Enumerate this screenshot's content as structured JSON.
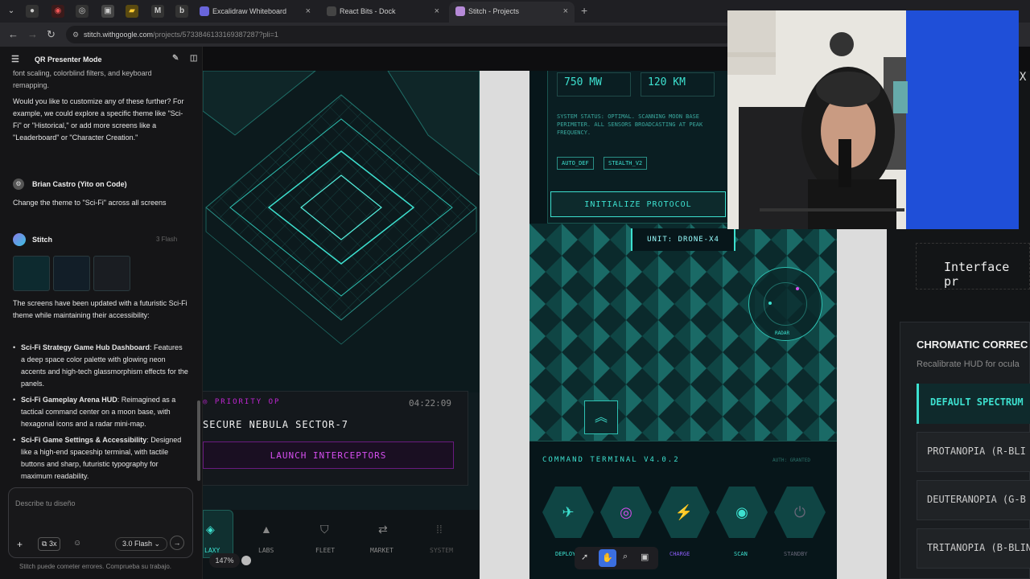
{
  "browser": {
    "tabs": [
      {
        "label": "Excalidraw Whiteboard",
        "active": false
      },
      {
        "label": "React Bits - Dock",
        "active": false
      },
      {
        "label": "Stitch - Projects",
        "active": true
      }
    ],
    "url_host": "stitch.withgoogle.com",
    "url_path": "/projects/5733846133169387287?pli=1"
  },
  "chat": {
    "title": "QR Presenter Mode",
    "intro_tail": "font scaling, colorblind filters, and keyboard remapping.",
    "question": "Would you like to customize any of these further? For example, we could explore a specific theme like \"Sci-Fi\" or \"Historical,\" or add more screens like a \"Leaderboard\" or \"Character Creation.\"",
    "user_name": "Brian Castro (Yito on Code)",
    "user_message": "Change the theme to \"Sci-Fi\" across all screens",
    "assistant_name": "Stitch",
    "assistant_badge": "3 Flash",
    "reply_intro": "The screens have been updated with a futuristic Sci-Fi theme while maintaining their accessibility:",
    "bullets": [
      {
        "title": "Sci-Fi Strategy Game Hub Dashboard",
        "text": ": Features a deep space color palette with glowing neon accents and high-tech glassmorphism effects for the panels."
      },
      {
        "title": "Sci-Fi Gameplay Arena HUD",
        "text": ": Reimagined as a tactical command center on a moon base, with hexagonal icons and a radar mini-map."
      },
      {
        "title": "Sci-Fi Game Settings & Accessibility",
        "text": ": Designed like a high-end spaceship terminal, with tactile buttons and sharp, futuristic typography for maximum readability."
      }
    ],
    "input_placeholder": "Describe tu diseño",
    "count_label": "3x",
    "model_label": "3.0 Flash",
    "disclaimer": "Stitch puede cometer errores. Comprueba su trabajo."
  },
  "screen1": {
    "priority_label": "PRIORITY OP",
    "timer": "04:22:09",
    "mission": "SECURE NEBULA SECTOR-7",
    "launch_button": "LAUNCH INTERCEPTORS",
    "nav": [
      "LAXY",
      "LABS",
      "FLEET",
      "MARKET",
      "SYSTEM"
    ],
    "zoom": "147%"
  },
  "screen2": {
    "stat1": "750 MW",
    "stat2": "120 KM",
    "status_text": "SYSTEM STATUS: OPTIMAL. SCANNING MOON BASE PERIMETER. ALL SENSORS BROADCASTING AT PEAK FREQUENCY.",
    "chips": [
      "AUTO_DEF",
      "STEALTH_V2"
    ],
    "init_button": "INITIALIZE PROTOCOL",
    "unit": "UNIT: DRONE-X4",
    "radar_label": "RADAR",
    "terminal_title": "COMMAND TERMINAL V4.0.2",
    "auth": "AUTH: GRANTED",
    "actions": [
      "DEPLOY",
      "",
      "CHARGE",
      "SCAN",
      "STANDBY"
    ]
  },
  "screen3": {
    "title_fragment": "IOX",
    "interface_text": "Interface pr",
    "chromatic_title": "CHROMATIC CORREC",
    "chromatic_sub": "Recalibrate HUD for ocula",
    "options": [
      "DEFAULT SPECTRUM",
      "PROTANOPIA (R-BLI",
      "DEUTERANOPIA (G-B",
      "TRITANOPIA (B-BLIN"
    ]
  },
  "colors": {
    "accent_cyan": "#2ee6d6",
    "accent_magenta": "#c026d3",
    "bg": "#07161a"
  }
}
